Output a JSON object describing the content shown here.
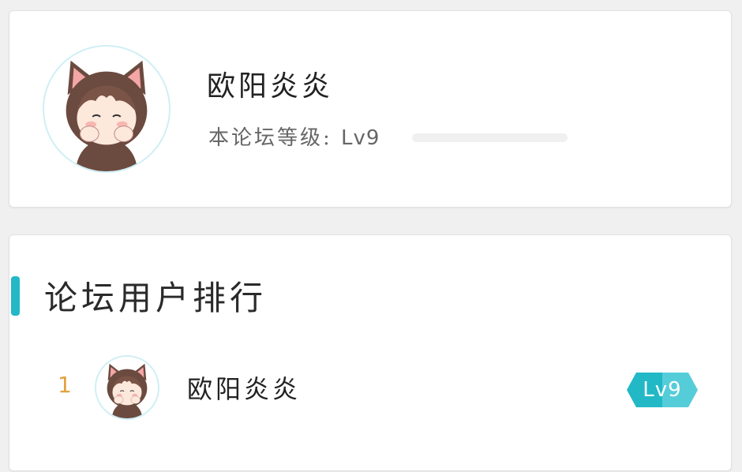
{
  "profile": {
    "username": "欧阳炎炎",
    "level_prefix": "本论坛等级:",
    "level_value": "Lv9",
    "progress_fraction": 0,
    "avatar_icon": "cat-hood-girl-avatar"
  },
  "ranking": {
    "title": "论坛用户排行",
    "accent_color": "#22b8c6",
    "users": [
      {
        "rank": "1",
        "name": "欧阳炎炎",
        "level": "Lv9",
        "avatar_icon": "cat-hood-girl-avatar"
      }
    ]
  },
  "colors": {
    "rank_number": "#e0a23c",
    "badge": "#22b8c6",
    "badge_light": "#55cdd9"
  }
}
